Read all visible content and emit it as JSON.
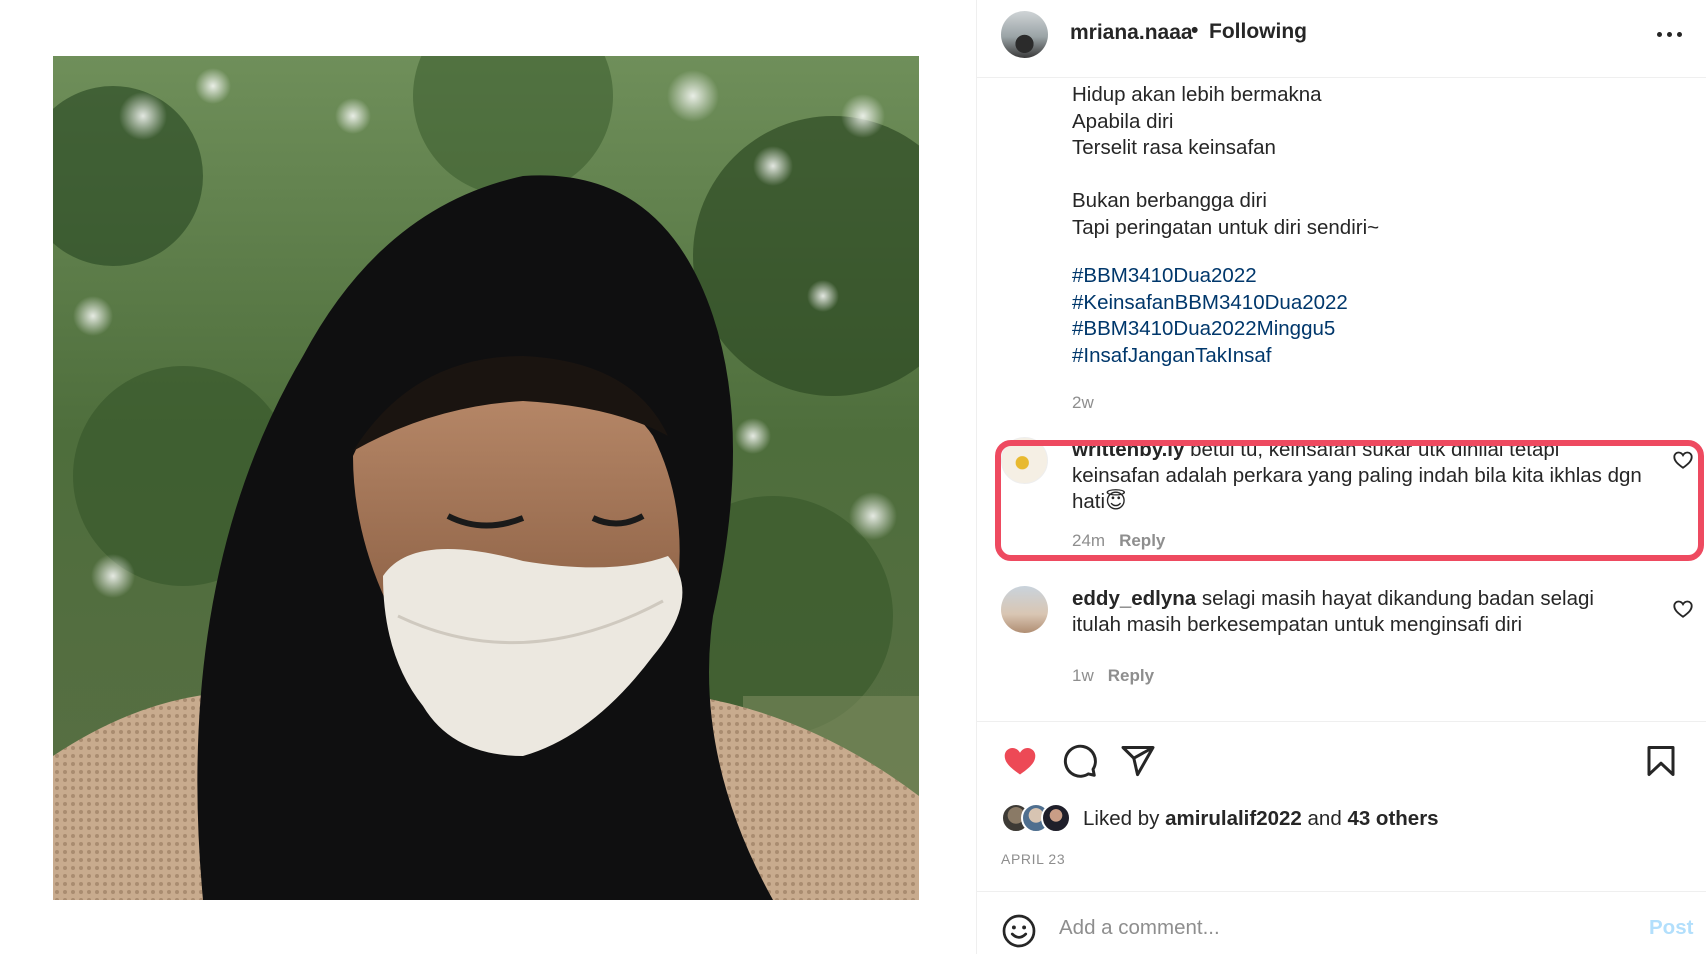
{
  "post": {
    "username": "mriana.naaa",
    "separator": "•",
    "follow_state": "Following",
    "more_icon": "more-horizontal-icon",
    "caption_lines": [
      "Hidup akan lebih bermakna",
      "Apabila diri",
      "Terselit rasa keinsafan",
      "",
      "Bukan berbangga diri",
      "Tapi peringatan untuk diri sendiri~"
    ],
    "hashtags": [
      "#BBM3410Dua2022",
      "#KeinsafanBBM3410Dua2022",
      "#BBM3410Dua2022Minggu5",
      "#InsafJanganTakInsaf"
    ],
    "caption_age": "2w"
  },
  "comments": [
    {
      "user": "writtenby.ly",
      "text": "betul tu, keinsafan sukar utk dinilai tetapi keinsafan adalah perkara yang paling indah bila kita ikhlas dgn hati",
      "emoji": "😇",
      "age": "24m",
      "reply_label": "Reply",
      "highlighted": true
    },
    {
      "user": "eddy_edlyna",
      "text": "selagi masih hayat dikandung badan selagi itulah masih berkesempatan untuk menginsafi diri",
      "emoji": "",
      "age": "1w",
      "reply_label": "Reply",
      "highlighted": false
    }
  ],
  "actions": {
    "like_icon": "heart-filled-icon",
    "comment_icon": "comment-icon",
    "share_icon": "send-icon",
    "save_icon": "bookmark-icon",
    "like_color": "#ed4956"
  },
  "likes": {
    "prefix": "Liked by",
    "user": "amirulalif2022",
    "joiner": "and",
    "others": "43 others"
  },
  "date": "APRIL 23",
  "composer": {
    "placeholder": "Add a comment...",
    "post_label": "Post",
    "emoji_icon": "smiley-icon"
  },
  "colors": {
    "highlight_border": "#ee4a60",
    "hashtag": "#00376b",
    "muted": "#8e8e8e",
    "post_button_disabled": "#b2dffc"
  }
}
